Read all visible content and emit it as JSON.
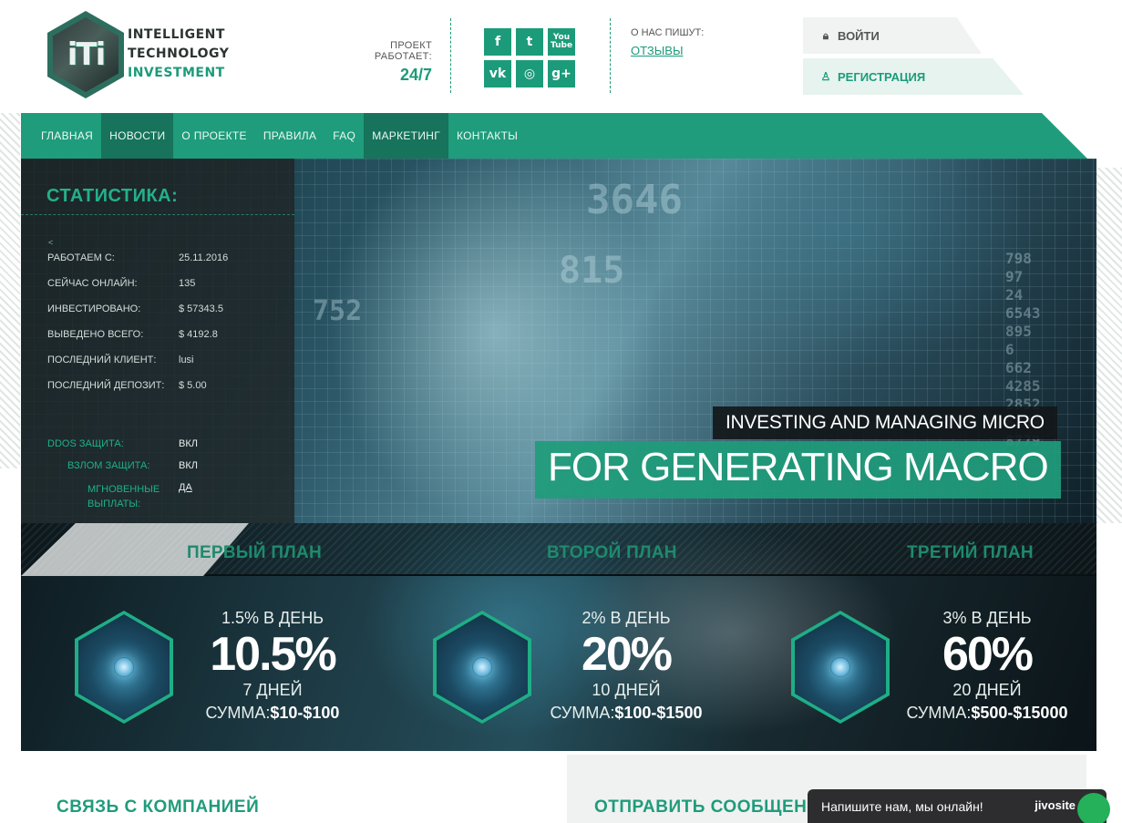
{
  "logo": {
    "mark": "iTi",
    "line1": "INTELLIGENT",
    "line2": "TECHNOLOGY",
    "line3": "INVESTMENT"
  },
  "works": {
    "label": "ПРОЕКТ РАБОТАЕТ:",
    "value": "24/7"
  },
  "socials": [
    {
      "name": "facebook-icon",
      "glyph": "f"
    },
    {
      "name": "twitter-icon",
      "glyph": "t"
    },
    {
      "name": "youtube-icon",
      "glyph": "You Tube"
    },
    {
      "name": "vk-icon",
      "glyph": "vk"
    },
    {
      "name": "instagram-icon",
      "glyph": "◎"
    },
    {
      "name": "google-plus-icon",
      "glyph": "g+"
    }
  ],
  "about": {
    "label": "О НАС ПИШУТ:",
    "link": "ОТЗЫВЫ"
  },
  "auth": {
    "login": "ВОЙТИ",
    "register": "РЕГИСТРАЦИЯ",
    "login_icon": "lock-icon",
    "register_icon": "user-icon"
  },
  "nav": {
    "items": [
      {
        "label": "ГЛАВНАЯ",
        "active": false
      },
      {
        "label": "НОВОСТИ",
        "active": true
      },
      {
        "label": "О ПРОЕКТЕ",
        "active": false
      },
      {
        "label": "ПРАВИЛА",
        "active": false
      },
      {
        "label": "FAQ",
        "active": false
      },
      {
        "label": "МАРКЕТИНГ",
        "active": true
      },
      {
        "label": "КОНТАКТЫ",
        "active": false
      }
    ]
  },
  "stats": {
    "title": "СТАТИСТИКА:",
    "caret": "<",
    "rows": [
      {
        "label": "РАБОТАЕМ С:",
        "value": "25.11.2016"
      },
      {
        "label": "СЕЙЧАС ОНЛАЙН:",
        "value": "135"
      },
      {
        "label": "ИНВЕСТИРОВАНО:",
        "value": "$ 57343.5"
      },
      {
        "label": "ВЫВЕДЕНО ВСЕГО:",
        "value": "$ 4192.8"
      },
      {
        "label": "ПОСЛЕДНИЙ КЛИЕНТ:",
        "value": "lusi"
      },
      {
        "label": "ПОСЛЕДНИЙ ДЕПОЗИТ:",
        "value": "$ 5.00"
      }
    ],
    "security": [
      {
        "label": "DDOS ЗАЩИТА:",
        "value": "ВКЛ"
      },
      {
        "label": "ВЗЛОМ ЗАЩИТА:",
        "value": "ВКЛ"
      },
      {
        "label": "МГНОВЕННЫЕ ВЫПЛАТЫ:",
        "value": "ДА"
      }
    ]
  },
  "hero": {
    "tagline_small": "INVESTING AND MANAGING MICRO",
    "tagline_big": "FOR GENERATING MACRO"
  },
  "plans": [
    {
      "title": "ПЕРВЫЙ ПЛАН",
      "rate": "1.5% В ДЕНЬ",
      "percent": "10.5%",
      "days": "7 ДНЕЙ",
      "sum_label": "СУММА:",
      "sum": "$10-$100"
    },
    {
      "title": "ВТОРОЙ ПЛАН",
      "rate": "2% В ДЕНЬ",
      "percent": "20%",
      "days": "10 ДНЕЙ",
      "sum_label": "СУММА:",
      "sum": "$100-$1500"
    },
    {
      "title": "ТРЕТИЙ ПЛАН",
      "rate": "3% В ДЕНЬ",
      "percent": "60%",
      "days": "20 ДНЕЙ",
      "sum_label": "СУММА:",
      "sum": "$500-$15000"
    }
  ],
  "contact": {
    "title": "СВЯЗЬ С КОМПАНИЕЙ",
    "message_title": "ОТПРАВИТЬ СООБЩЕНИЕ"
  },
  "chat": {
    "text": "Напишите нам, мы онлайн!",
    "brand": "jivosite"
  },
  "colors": {
    "accent": "#1f9c7b",
    "nav_active": "#17735b",
    "dark": "#2d2d2f"
  }
}
